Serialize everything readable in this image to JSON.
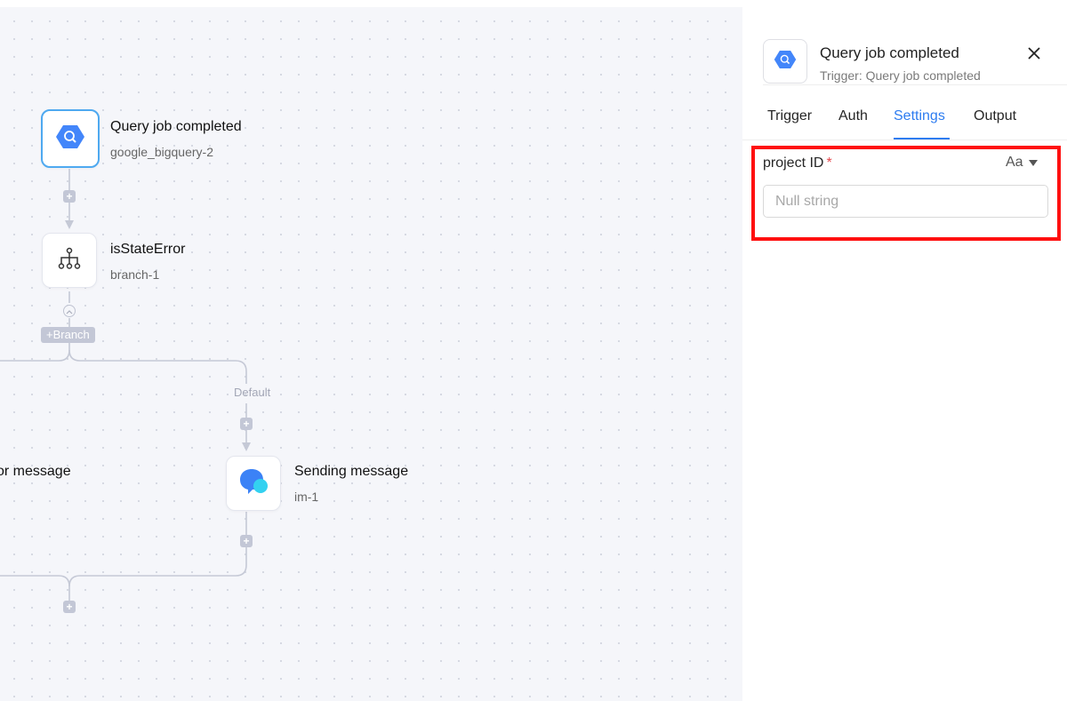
{
  "canvas": {
    "nodes": [
      {
        "title": "Query job completed",
        "subtitle": "google_bigquery-2",
        "icon": "bigquery-icon"
      },
      {
        "title": "isStateError",
        "subtitle": "branch-1",
        "icon": "branch-icon"
      },
      {
        "title": "or message",
        "subtitle": "",
        "icon": ""
      },
      {
        "title": "Sending message",
        "subtitle": "im-1",
        "icon": "chat-bubbles-icon"
      }
    ],
    "branch_button_label": "+Branch",
    "default_edge_label": "Default",
    "plus_label": "+"
  },
  "panel": {
    "title": "Query job completed",
    "subtitle": "Trigger: Query job completed",
    "close_icon": "close-icon",
    "tabs": [
      {
        "label": "Trigger",
        "active": false
      },
      {
        "label": "Auth",
        "active": false
      },
      {
        "label": "Settings",
        "active": true
      },
      {
        "label": "Output",
        "active": false
      }
    ],
    "field": {
      "label": "project ID",
      "required_mark": "*",
      "type_toggle_label": "Aa",
      "placeholder": "Null string",
      "value": ""
    }
  },
  "colors": {
    "accent": "#2d7cf0",
    "selected_node_border": "#4ea9f0",
    "highlight_box": "#ff1010",
    "required": "#e5484d"
  }
}
